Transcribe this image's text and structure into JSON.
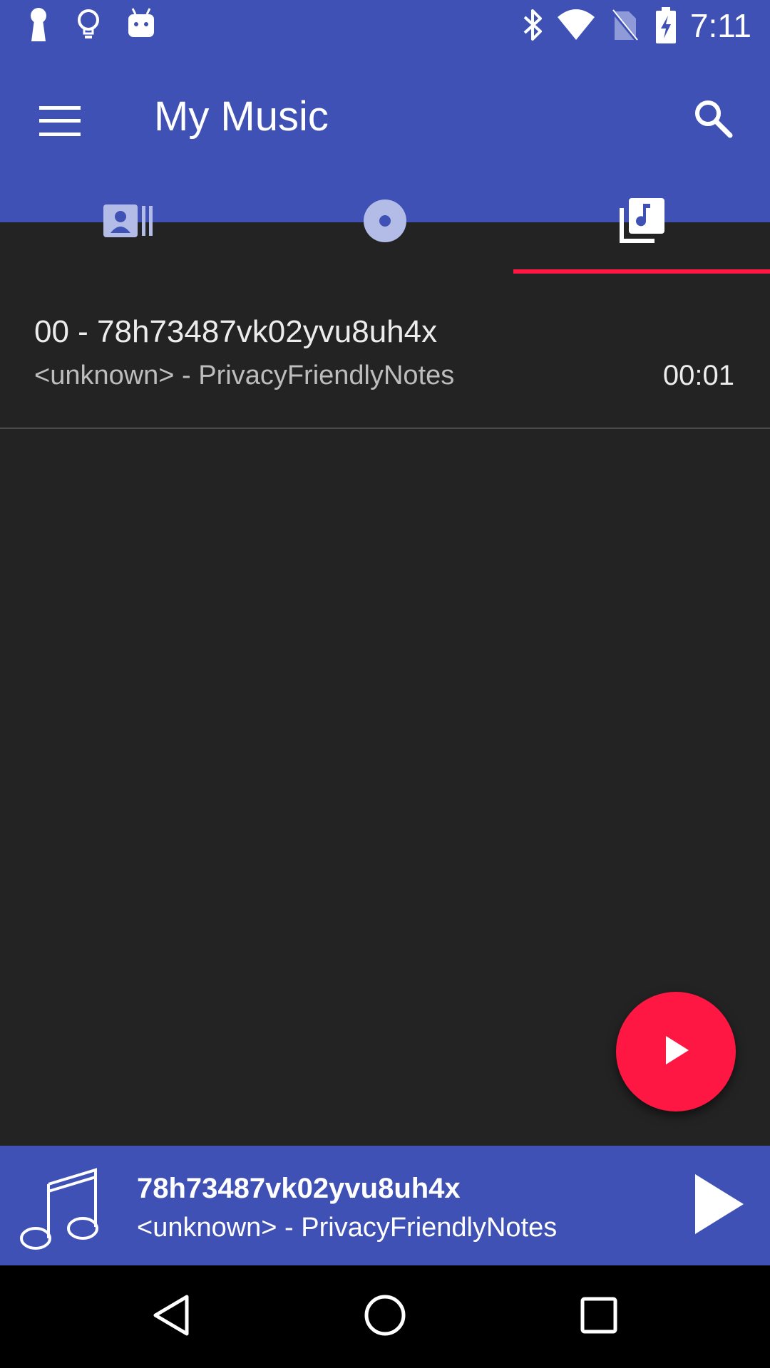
{
  "status_bar": {
    "time": "7:11",
    "icons": [
      "keyhole-icon",
      "lightbulb-icon",
      "android-icon",
      "bluetooth-icon",
      "wifi-icon",
      "no-sim-icon",
      "battery-charging-icon"
    ]
  },
  "app_bar": {
    "title": "My Music",
    "menu_icon": "hamburger-menu-icon",
    "search_icon": "search-icon"
  },
  "tabs": [
    {
      "icon": "artists-icon",
      "selected": false
    },
    {
      "icon": "album-disc-icon",
      "selected": false
    },
    {
      "icon": "song-library-icon",
      "selected": true
    }
  ],
  "songs": [
    {
      "title": "00 - 78h73487vk02yvu8uh4x",
      "subtitle": "<unknown> - PrivacyFriendlyNotes",
      "duration": "00:01"
    }
  ],
  "fab": {
    "icon": "play-icon"
  },
  "mini_player": {
    "title": "78h73487vk02yvu8uh4x",
    "subtitle": "<unknown> - PrivacyFriendlyNotes",
    "art_icon": "music-note-icon",
    "play_icon": "play-icon"
  },
  "nav_bar": {
    "buttons": [
      "back-icon",
      "home-icon",
      "recents-icon"
    ]
  },
  "colors": {
    "primary": "#3f51b5",
    "accent": "#ff1744",
    "background": "#232323"
  }
}
